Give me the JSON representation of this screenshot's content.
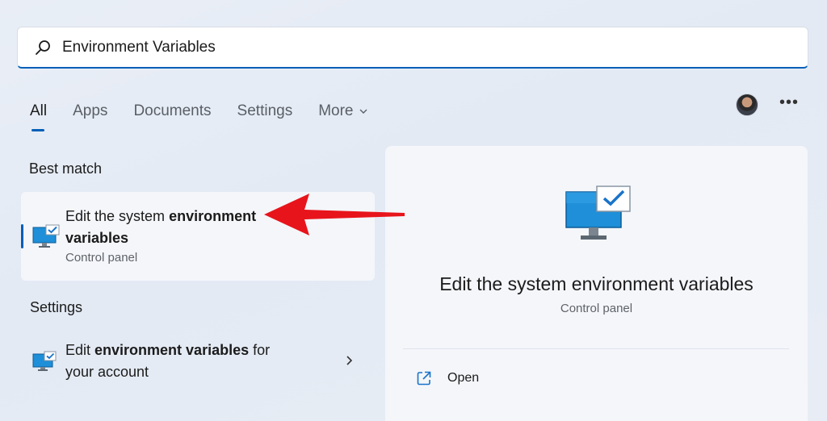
{
  "search": {
    "query": "Environment Variables"
  },
  "tabs": [
    {
      "label": "All"
    },
    {
      "label": "Apps"
    },
    {
      "label": "Documents"
    },
    {
      "label": "Settings"
    },
    {
      "label": "More"
    }
  ],
  "best_match": {
    "section_label": "Best match",
    "title_prefix": "Edit the system ",
    "title_bold_1": "environment",
    "title_bold_2": "variables",
    "subtitle": "Control panel"
  },
  "settings": {
    "section_label": "Settings",
    "item": {
      "title_prefix": "Edit ",
      "title_bold": "environment variables",
      "title_suffix": " for",
      "title_line2": "your account"
    }
  },
  "detail": {
    "title": "Edit the system environment variables",
    "subtitle": "Control panel",
    "open_label": "Open"
  },
  "colors": {
    "accent": "#005fb8",
    "annotation_arrow": "#e8141b"
  },
  "icons": {
    "search": "search-icon",
    "more": "more-dots-icon",
    "chevron_down": "chevron-down-icon",
    "chevron_right": "chevron-right-icon",
    "app": "monitor-check-icon",
    "open": "open-external-icon"
  }
}
